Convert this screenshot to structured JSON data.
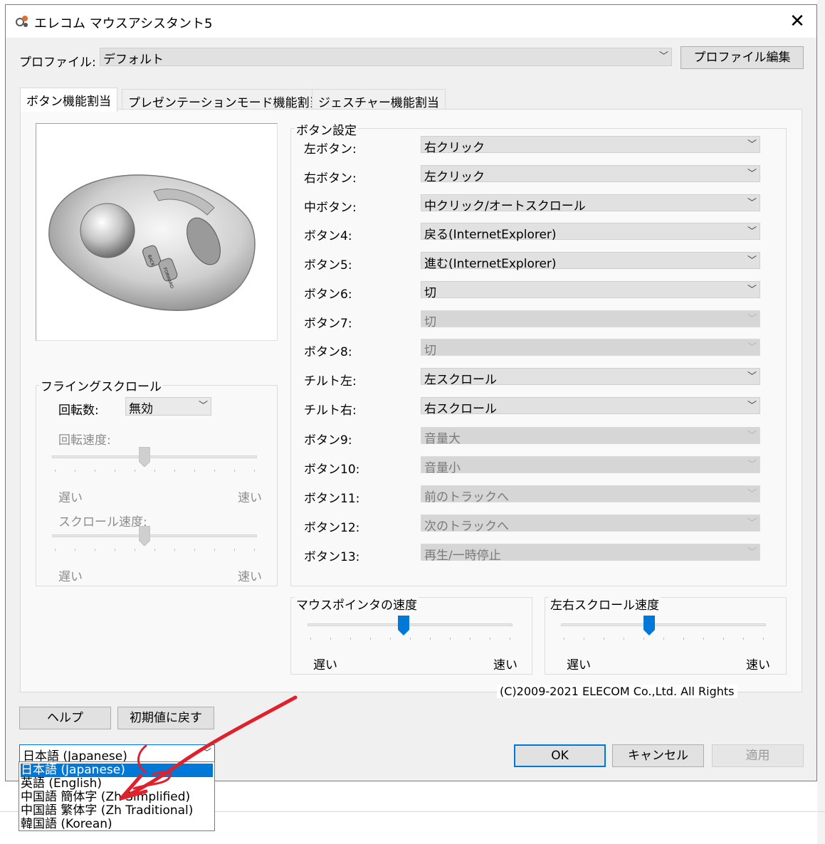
{
  "window": {
    "title": "エレコム マウスアシスタント5",
    "close_glyph": "✕"
  },
  "profile": {
    "label": "プロファイル:",
    "value": "デフォルト",
    "edit_button": "プロファイル編集"
  },
  "tabs": [
    {
      "label": "ボタン機能割当",
      "active": true
    },
    {
      "label": "プレゼンテーションモード機能割当",
      "active": false
    },
    {
      "label": "ジェスチャー機能割当",
      "active": false
    }
  ],
  "button_settings": {
    "title": "ボタン設定",
    "rows": [
      {
        "label": "左ボタン:",
        "value": "右クリック",
        "enabled": true
      },
      {
        "label": "右ボタン:",
        "value": "左クリック",
        "enabled": true
      },
      {
        "label": "中ボタン:",
        "value": "中クリック/オートスクロール",
        "enabled": true
      },
      {
        "label": "ボタン4:",
        "value": "戻る(InternetExplorer)",
        "enabled": true
      },
      {
        "label": "ボタン5:",
        "value": "進む(InternetExplorer)",
        "enabled": true
      },
      {
        "label": "ボタン6:",
        "value": "切",
        "enabled": true
      },
      {
        "label": "ボタン7:",
        "value": "切",
        "enabled": false
      },
      {
        "label": "ボタン8:",
        "value": "切",
        "enabled": false
      },
      {
        "label": "チルト左:",
        "value": "左スクロール",
        "enabled": true
      },
      {
        "label": "チルト右:",
        "value": "右スクロール",
        "enabled": true
      },
      {
        "label": "ボタン9:",
        "value": "音量大",
        "enabled": false
      },
      {
        "label": "ボタン10:",
        "value": "音量小",
        "enabled": false
      },
      {
        "label": "ボタン11:",
        "value": "前のトラックへ",
        "enabled": false
      },
      {
        "label": "ボタン12:",
        "value": "次のトラックへ",
        "enabled": false
      },
      {
        "label": "ボタン13:",
        "value": "再生/一時停止",
        "enabled": false
      }
    ]
  },
  "mouse_buttons": {
    "back": "BACK",
    "forward": "FORWARD"
  },
  "flying_scroll": {
    "title": "フライングスクロール",
    "rotation_label": "回転数:",
    "rotation_value": "無効",
    "rotation_speed_label": "回転速度:",
    "scroll_speed_label": "スクロール速度:",
    "slow": "遅い",
    "fast": "速い",
    "rotation_speed_level": 0.45,
    "scroll_speed_level": 0.45
  },
  "pointer_speed": {
    "title": "マウスポインタの速度",
    "slow": "遅い",
    "fast": "速い",
    "level": 0.47
  },
  "hscroll_speed": {
    "title": "左右スクロール速度",
    "slow": "遅い",
    "fast": "速い",
    "level": 0.43
  },
  "copyright": "(C)2009-2021 ELECOM Co.,Ltd. All Rights",
  "footer": {
    "help": "ヘルプ",
    "reset": "初期値に戻す",
    "ok": "OK",
    "cancel": "キャンセル",
    "apply": "適用"
  },
  "language": {
    "selected": "日本語 (Japanese)",
    "options": [
      "日本語 (Japanese)",
      "英語 (English)",
      "中国語 簡体字 (Zh Simplified)",
      "中国語 繁体字 (Zh Traditional)",
      "韓国語 (Korean)"
    ],
    "highlighted_index": 0
  },
  "colors": {
    "accent": "#0078d7",
    "annotation": "#e0202a",
    "window_bg": "#f0f0f0"
  }
}
